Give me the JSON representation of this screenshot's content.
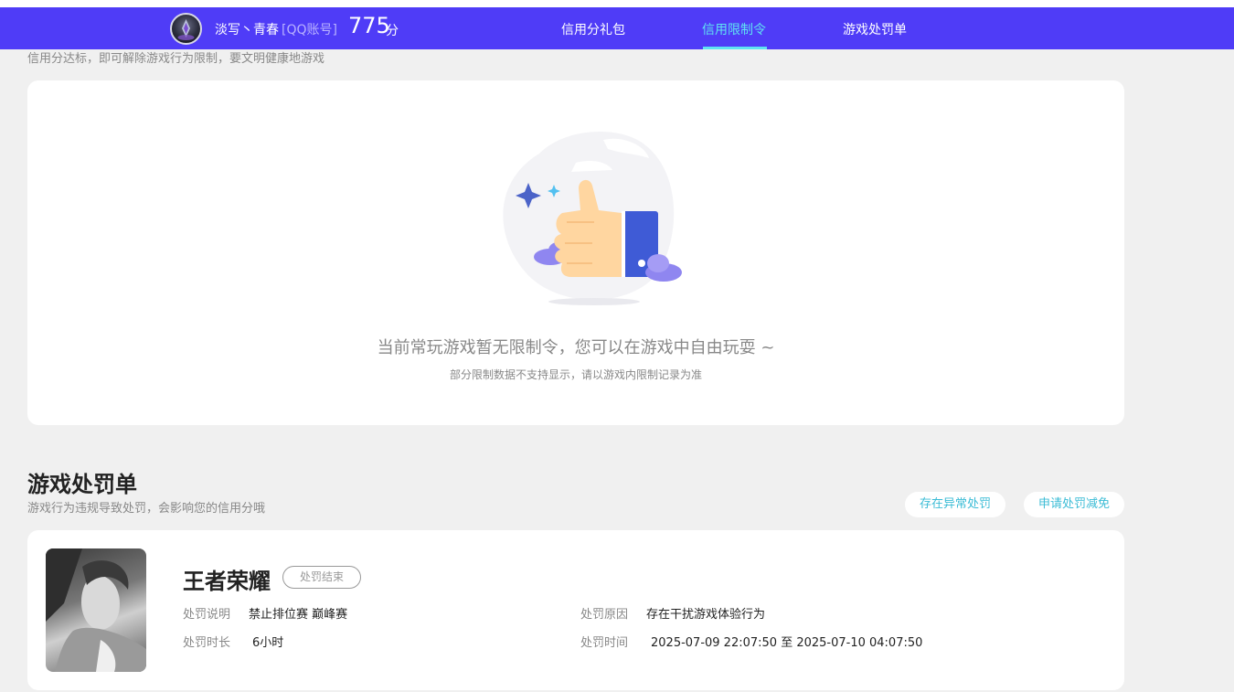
{
  "header": {
    "nickname": "淡写丶青春",
    "account_type": "[QQ账号]",
    "score": "775",
    "score_unit": "分",
    "tabs": [
      {
        "label": "信用分礼包",
        "active": false
      },
      {
        "label": "信用限制令",
        "active": true
      },
      {
        "label": "游戏处罚单",
        "active": false
      }
    ],
    "bg_color": "#4f3cf7",
    "active_color": "#5fe3f2"
  },
  "restriction": {
    "description": "信用分达标，即可解除游戏行为限制，要文明健康地游戏",
    "empty_title": "当前常玩游戏暂无限制令，您可以在游戏中自由玩耍 ~",
    "empty_note": "部分限制数据不支持显示，请以游戏内限制记录为准",
    "illustration_icon": "thumbs-up-icon"
  },
  "penalty_section": {
    "title": "游戏处罚单",
    "description": "游戏行为违规导致处罚，会影响您的信用分哦",
    "abnormal_button": "存在异常处罚",
    "appeal_button": "申请处罚减免"
  },
  "penalty": {
    "game_name": "王者荣耀",
    "status": "处罚结束",
    "desc_label": "处罚说明",
    "desc_value": "禁止排位赛 巅峰赛",
    "reason_label": "处罚原因",
    "reason_value": "存在干扰游戏体验行为",
    "duration_label": "处罚时长",
    "duration_value": "6小时",
    "time_label": "处罚时间",
    "time_value": "2025-07-09 22:07:50 至 2025-07-10 04:07:50"
  }
}
